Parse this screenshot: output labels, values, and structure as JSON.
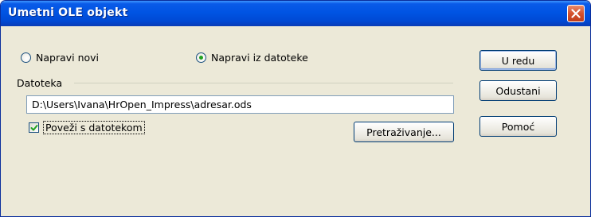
{
  "window": {
    "title": "Umetni OLE objekt"
  },
  "icons": {
    "close": "close-icon",
    "radio": "radio-icon",
    "check": "checkmark-icon"
  },
  "options": {
    "create_new_label": "Napravi novi",
    "create_new_selected": false,
    "from_file_label": "Napravi iz datoteke",
    "from_file_selected": true
  },
  "file_section": {
    "label": "Datoteka",
    "path_value": "D:\\Users\\Ivana\\HrOpen_Impress\\adresar.ods",
    "link_label": "Poveži s datotekom",
    "link_checked": true,
    "browse_label": "Pretraživanje..."
  },
  "buttons": {
    "ok_label": "U redu",
    "cancel_label": "Odustani",
    "help_label": "Pomoć"
  },
  "colors": {
    "titlebar": "#0054e3",
    "close_button": "#d4512d",
    "dialog_background": "#ece9d8",
    "radio_selected_dot": "#21a121",
    "checkmark": "#21a121"
  }
}
